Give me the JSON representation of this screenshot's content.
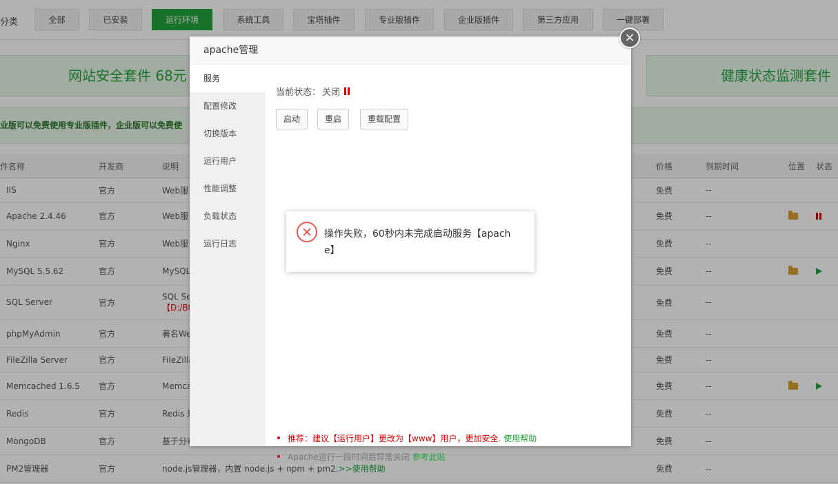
{
  "categories": {
    "label": "分类",
    "items": [
      "全部",
      "已安装",
      "运行环境",
      "系统工具",
      "宝塔插件",
      "专业版插件",
      "企业版插件",
      "第三方应用",
      "一键部署"
    ],
    "active": "运行环境"
  },
  "banners": {
    "left": "网站安全套件 68元",
    "right": "健康状态监测套件"
  },
  "notice": "业版可以免费使用专业版插件，企业版可以免费使",
  "table": {
    "headers": {
      "name": "件名称",
      "developer": "开发商",
      "description": "说明",
      "price": "价格",
      "expire": "到期时间",
      "location": "位置",
      "status": "状态"
    },
    "rows": [
      {
        "name": "IIS",
        "developer": "官方",
        "description": "Web服",
        "price": "免费",
        "expire": "--"
      },
      {
        "name": "Apache 2.4.46",
        "developer": "官方",
        "description": "Web服",
        "price": "免费",
        "expire": "--"
      },
      {
        "name": "Nginx",
        "developer": "官方",
        "description": "Web服",
        "price": "免费",
        "expire": "--"
      },
      {
        "name": "MySQL 5.5.62",
        "developer": "官方",
        "description": "MySQL",
        "price": "免费",
        "expire": "--"
      },
      {
        "name": "SQL Server",
        "developer": "官方",
        "description": "SQL Se",
        "description2": "【D:/Bt",
        "price": "免费",
        "expire": "--"
      },
      {
        "name": "phpMyAdmin",
        "developer": "官方",
        "description": "著名We",
        "price": "免费",
        "expire": "--"
      },
      {
        "name": "FileZilla Server",
        "developer": "官方",
        "description": "FileZilla",
        "price": "免费",
        "expire": "--"
      },
      {
        "name": "Memcached 1.6.5",
        "developer": "官方",
        "description": "Memca",
        "price": "免费",
        "expire": "--"
      },
      {
        "name": "Redis",
        "developer": "官方",
        "description": "Redis 是",
        "price": "免费",
        "expire": "--"
      },
      {
        "name": "MongoDB",
        "developer": "官方",
        "description": "基于分布",
        "price": "免费",
        "expire": "--"
      },
      {
        "name": "PM2管理器",
        "developer": "官方",
        "description": "node.js管理器，内置 node.js + npm + pm2. ",
        "link": ">>使用帮助",
        "price": "免费",
        "expire": "--"
      }
    ]
  },
  "modal": {
    "title": "apache管理",
    "menu": [
      "服务",
      "配置修改",
      "切换版本",
      "运行用户",
      "性能调整",
      "负载状态",
      "运行日志"
    ],
    "active_menu": "服务",
    "status_label": "当前状态：",
    "status_value": "关闭",
    "buttons": {
      "start": "启动",
      "restart": "重启",
      "reload": "重载配置"
    },
    "tips": [
      {
        "text": "推荐：建议【运行用户】更改为【www】用户，更加安全. ",
        "link": "使用帮助"
      },
      {
        "text": "Apache运行一段时间后异常关闭 ",
        "link": "参考此贴"
      }
    ],
    "close": "×"
  },
  "message": {
    "text": "操作失败，60秒内未完成启动服务【apache】"
  },
  "colors": {
    "accent": "#20a53a",
    "danger": "#dd0000",
    "error_icon": "#e8594f"
  }
}
